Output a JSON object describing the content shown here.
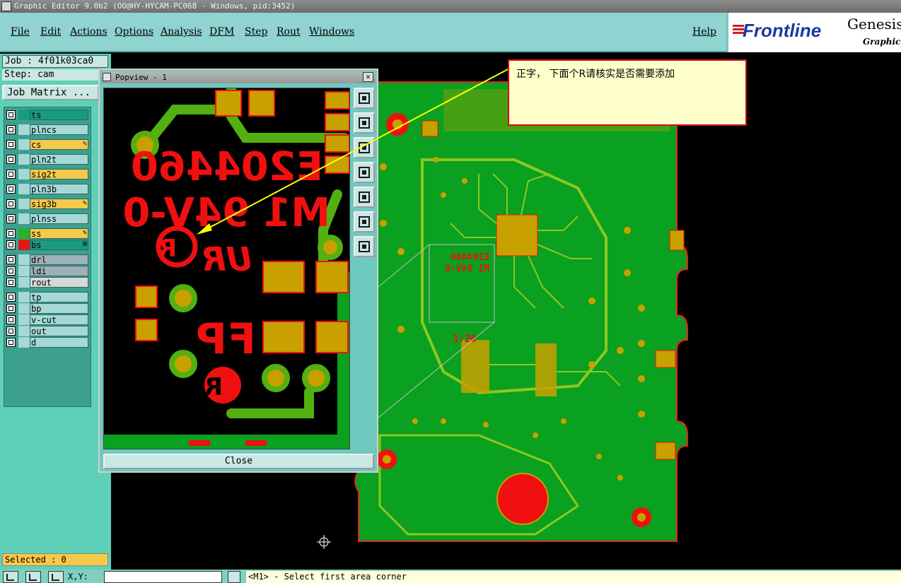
{
  "window": {
    "title": "Graphic Editor 9.0b2 (OO@HY-HYCAM-PC068 - Windows, pid:3452)"
  },
  "menu": [
    "File",
    "Edit",
    "Actions",
    "Options",
    "Analysis",
    "DFM",
    "Step",
    "Rout",
    "Windows"
  ],
  "help_label": "Help",
  "logo": {
    "brand": "Frontline",
    "product": "Genesis",
    "sub": "Graphic E"
  },
  "job": {
    "job_label": "Job : 4f01k03ca0",
    "step_label": "Step: cam",
    "matrix_button": "Job Matrix ..."
  },
  "layers": [
    {
      "name": "ts",
      "color": "#1a9a80",
      "swatch": "#1a9a80"
    },
    {
      "name": "plncs",
      "color": "#a6d8d6",
      "swatch": "#a6d8d6"
    },
    {
      "name": "cs",
      "color": "#f5c94a",
      "swatch": "#a6d8d6",
      "mark": "✎"
    },
    {
      "name": "pln2t",
      "color": "#a6d8d6",
      "swatch": "#a6d8d6"
    },
    {
      "name": "sig2t",
      "color": "#f5c94a",
      "swatch": "#a6d8d6"
    },
    {
      "name": "pln3b",
      "color": "#a6d8d6",
      "swatch": "#a6d8d6"
    },
    {
      "name": "sig3b",
      "color": "#f5c94a",
      "swatch": "#a6d8d6",
      "mark": "✎"
    },
    {
      "name": "plnss",
      "color": "#a6d8d6",
      "swatch": "#a6d8d6"
    },
    {
      "name": "ss",
      "color": "#f5c94a",
      "swatch": "#28b02a",
      "mark": "✎"
    },
    {
      "name": "bs",
      "color": "#1a9a80",
      "swatch": "#e01818",
      "mark": "⊞"
    },
    {
      "name": "drl",
      "color": "#9fb0b8",
      "swatch": "#a6d8d6"
    },
    {
      "name": "ldi",
      "color": "#9fb0b8",
      "swatch": "#a6d8d6"
    },
    {
      "name": "rout",
      "color": "#d8d8d8",
      "swatch": "#a6d8d6"
    },
    {
      "name": "tp",
      "color": "#a6d8d6",
      "swatch": "#a6d8d6"
    },
    {
      "name": "bp",
      "color": "#a6d8d6",
      "swatch": "#a6d8d6"
    },
    {
      "name": "v-cut",
      "color": "#a6d8d6",
      "swatch": "#a6d8d6"
    },
    {
      "name": "out",
      "color": "#a6d8d6",
      "swatch": "#a6d8d6"
    },
    {
      "name": "d",
      "color": "#a6d8d6",
      "swatch": "#a6d8d6"
    }
  ],
  "selected_label": "Selected : 0",
  "popview": {
    "title": "Popview - 1",
    "close_label": "Close",
    "silkscreen": {
      "part_no": "E204460",
      "rating": "M1 94V-0",
      "mark": "FP",
      "date": "3:20"
    }
  },
  "annotation": {
    "text": "正字， 下面个R请核实是否需要添加"
  },
  "board": {
    "silk_mark": "E204460\nM1 94V-0"
  },
  "statusbar": {
    "xy_label": "X,Y:",
    "message": "<M1> - Select first area corner"
  },
  "colors": {
    "board_green": "#0aa020",
    "copper": "#c8a000",
    "pad_red": "#f01010",
    "trace_green": "#52b010",
    "accent": "#8fd4d0"
  }
}
